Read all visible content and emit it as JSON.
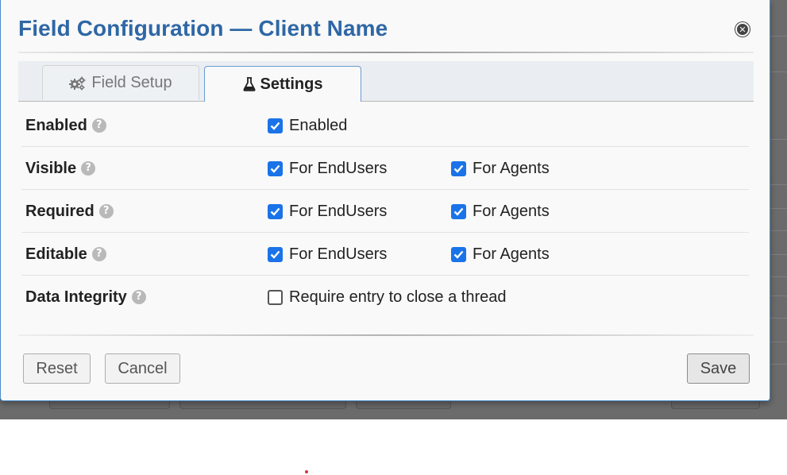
{
  "modal": {
    "title": "Field Configuration — Client Name",
    "close_icon": "close-circle-icon"
  },
  "tabs": [
    {
      "label": "Field Setup",
      "icon": "gears-icon",
      "active": false
    },
    {
      "label": "Settings",
      "icon": "flask-icon",
      "active": true
    }
  ],
  "rows": [
    {
      "label": "Enabled",
      "options": [
        {
          "label": "Enabled",
          "checked": true
        }
      ]
    },
    {
      "label": "Visible",
      "options": [
        {
          "label": "For EndUsers",
          "checked": true
        },
        {
          "label": "For Agents",
          "checked": true
        }
      ]
    },
    {
      "label": "Required",
      "options": [
        {
          "label": "For EndUsers",
          "checked": true
        },
        {
          "label": "For Agents",
          "checked": true
        }
      ]
    },
    {
      "label": "Editable",
      "options": [
        {
          "label": "For EndUsers",
          "checked": true
        },
        {
          "label": "For Agents",
          "checked": true
        }
      ]
    },
    {
      "label": "Data Integrity",
      "options": [
        {
          "label": "Require entry to close a thread",
          "checked": false
        }
      ]
    }
  ],
  "help_icon": "question-circle-icon",
  "buttons": {
    "reset": "Reset",
    "cancel": "Cancel",
    "save": "Save"
  },
  "colors": {
    "title": "#2f67a5",
    "checkbox_checked": "#1a73e8",
    "modal_border": "#4a8bc9"
  }
}
